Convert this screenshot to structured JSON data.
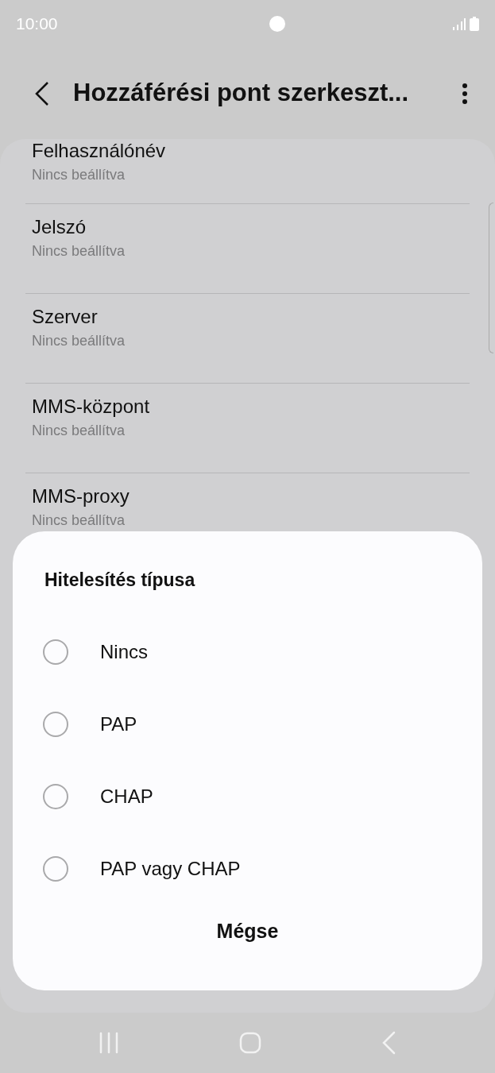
{
  "status_bar": {
    "time": "10:00"
  },
  "header": {
    "title": "Hozzáférési pont szerkeszt..."
  },
  "settings": [
    {
      "title": "Felhasználónév",
      "value": "Nincs beállítva"
    },
    {
      "title": "Jelszó",
      "value": "Nincs beállítva"
    },
    {
      "title": "Szerver",
      "value": "Nincs beállítva"
    },
    {
      "title": "MMS-központ",
      "value": "Nincs beállítva"
    },
    {
      "title": "MMS-proxy",
      "value": "Nincs beállítva"
    }
  ],
  "dialog": {
    "title": "Hitelesítés típusa",
    "options": [
      {
        "label": "Nincs",
        "selected": false
      },
      {
        "label": "PAP",
        "selected": false
      },
      {
        "label": "CHAP",
        "selected": false
      },
      {
        "label": "PAP vagy CHAP",
        "selected": false
      }
    ],
    "cancel": "Mégse"
  }
}
